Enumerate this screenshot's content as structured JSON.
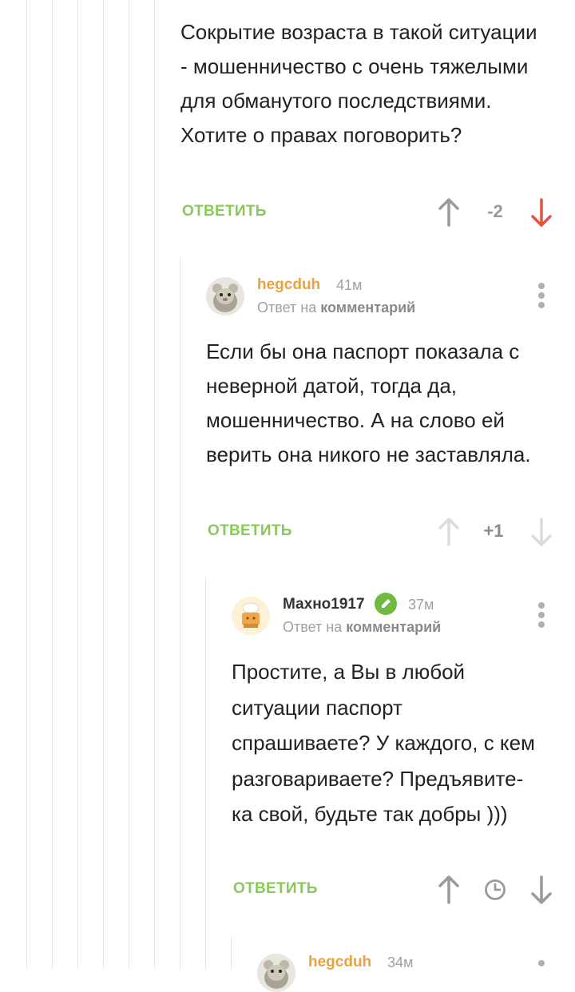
{
  "comments": [
    {
      "text": "Сокрытие возраста в такой ситуации - мошенничество с очень тяжелыми для обманутого последствиями. Хотите о правах поговорить?",
      "reply_label": "ОТВЕТИТЬ",
      "rating": "-2"
    },
    {
      "author": "hegcduh",
      "time": "41м",
      "reply_to_prefix": "Ответ на",
      "reply_to_link": "комментарий",
      "text": "Если бы она паспорт показала с неверной датой, тогда да, мошенничество. А на слово ей верить она никого не заставляла.",
      "reply_label": "ОТВЕТИТЬ",
      "rating": "+1"
    },
    {
      "author": "Махно1917",
      "time": "37м",
      "reply_to_prefix": "Ответ на",
      "reply_to_link": "комментарий",
      "text": "Простите, а Вы в любой ситуации паспорт спрашиваете? У каждого, с кем разговариваете? Предъявите-ка свой, будьте так добры )))",
      "reply_label": "ОТВЕТИТЬ"
    },
    {
      "author": "hegcduh",
      "time": "34м"
    }
  ],
  "colors": {
    "accent_green": "#8ac858",
    "author_orange": "#e8a33c",
    "downvote_red": "#e8513d",
    "icon_gray": "#9a9a9a"
  },
  "icons": [
    "arrow-up-icon",
    "arrow-down-icon",
    "clock-icon",
    "more-dots-icon",
    "pencil-badge-icon"
  ]
}
